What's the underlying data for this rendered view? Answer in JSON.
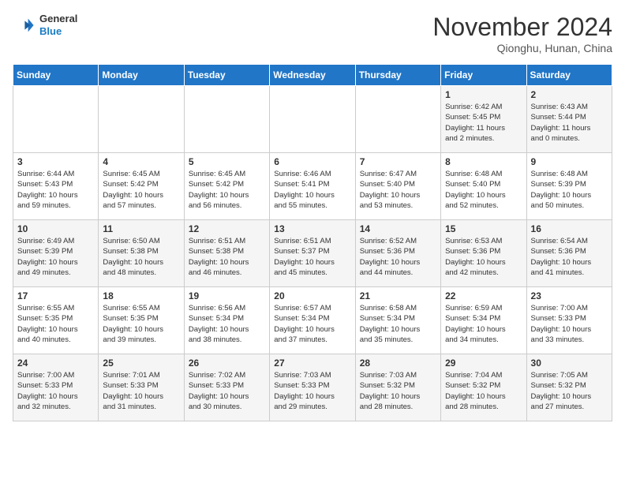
{
  "header": {
    "logo": {
      "line1": "General",
      "line2": "Blue"
    },
    "title": "November 2024",
    "location": "Qionghu, Hunan, China"
  },
  "weekdays": [
    "Sunday",
    "Monday",
    "Tuesday",
    "Wednesday",
    "Thursday",
    "Friday",
    "Saturday"
  ],
  "weeks": [
    [
      {
        "day": "",
        "info": ""
      },
      {
        "day": "",
        "info": ""
      },
      {
        "day": "",
        "info": ""
      },
      {
        "day": "",
        "info": ""
      },
      {
        "day": "",
        "info": ""
      },
      {
        "day": "1",
        "info": "Sunrise: 6:42 AM\nSunset: 5:45 PM\nDaylight: 11 hours\nand 2 minutes."
      },
      {
        "day": "2",
        "info": "Sunrise: 6:43 AM\nSunset: 5:44 PM\nDaylight: 11 hours\nand 0 minutes."
      }
    ],
    [
      {
        "day": "3",
        "info": "Sunrise: 6:44 AM\nSunset: 5:43 PM\nDaylight: 10 hours\nand 59 minutes."
      },
      {
        "day": "4",
        "info": "Sunrise: 6:45 AM\nSunset: 5:42 PM\nDaylight: 10 hours\nand 57 minutes."
      },
      {
        "day": "5",
        "info": "Sunrise: 6:45 AM\nSunset: 5:42 PM\nDaylight: 10 hours\nand 56 minutes."
      },
      {
        "day": "6",
        "info": "Sunrise: 6:46 AM\nSunset: 5:41 PM\nDaylight: 10 hours\nand 55 minutes."
      },
      {
        "day": "7",
        "info": "Sunrise: 6:47 AM\nSunset: 5:40 PM\nDaylight: 10 hours\nand 53 minutes."
      },
      {
        "day": "8",
        "info": "Sunrise: 6:48 AM\nSunset: 5:40 PM\nDaylight: 10 hours\nand 52 minutes."
      },
      {
        "day": "9",
        "info": "Sunrise: 6:48 AM\nSunset: 5:39 PM\nDaylight: 10 hours\nand 50 minutes."
      }
    ],
    [
      {
        "day": "10",
        "info": "Sunrise: 6:49 AM\nSunset: 5:39 PM\nDaylight: 10 hours\nand 49 minutes."
      },
      {
        "day": "11",
        "info": "Sunrise: 6:50 AM\nSunset: 5:38 PM\nDaylight: 10 hours\nand 48 minutes."
      },
      {
        "day": "12",
        "info": "Sunrise: 6:51 AM\nSunset: 5:38 PM\nDaylight: 10 hours\nand 46 minutes."
      },
      {
        "day": "13",
        "info": "Sunrise: 6:51 AM\nSunset: 5:37 PM\nDaylight: 10 hours\nand 45 minutes."
      },
      {
        "day": "14",
        "info": "Sunrise: 6:52 AM\nSunset: 5:36 PM\nDaylight: 10 hours\nand 44 minutes."
      },
      {
        "day": "15",
        "info": "Sunrise: 6:53 AM\nSunset: 5:36 PM\nDaylight: 10 hours\nand 42 minutes."
      },
      {
        "day": "16",
        "info": "Sunrise: 6:54 AM\nSunset: 5:36 PM\nDaylight: 10 hours\nand 41 minutes."
      }
    ],
    [
      {
        "day": "17",
        "info": "Sunrise: 6:55 AM\nSunset: 5:35 PM\nDaylight: 10 hours\nand 40 minutes."
      },
      {
        "day": "18",
        "info": "Sunrise: 6:55 AM\nSunset: 5:35 PM\nDaylight: 10 hours\nand 39 minutes."
      },
      {
        "day": "19",
        "info": "Sunrise: 6:56 AM\nSunset: 5:34 PM\nDaylight: 10 hours\nand 38 minutes."
      },
      {
        "day": "20",
        "info": "Sunrise: 6:57 AM\nSunset: 5:34 PM\nDaylight: 10 hours\nand 37 minutes."
      },
      {
        "day": "21",
        "info": "Sunrise: 6:58 AM\nSunset: 5:34 PM\nDaylight: 10 hours\nand 35 minutes."
      },
      {
        "day": "22",
        "info": "Sunrise: 6:59 AM\nSunset: 5:34 PM\nDaylight: 10 hours\nand 34 minutes."
      },
      {
        "day": "23",
        "info": "Sunrise: 7:00 AM\nSunset: 5:33 PM\nDaylight: 10 hours\nand 33 minutes."
      }
    ],
    [
      {
        "day": "24",
        "info": "Sunrise: 7:00 AM\nSunset: 5:33 PM\nDaylight: 10 hours\nand 32 minutes."
      },
      {
        "day": "25",
        "info": "Sunrise: 7:01 AM\nSunset: 5:33 PM\nDaylight: 10 hours\nand 31 minutes."
      },
      {
        "day": "26",
        "info": "Sunrise: 7:02 AM\nSunset: 5:33 PM\nDaylight: 10 hours\nand 30 minutes."
      },
      {
        "day": "27",
        "info": "Sunrise: 7:03 AM\nSunset: 5:33 PM\nDaylight: 10 hours\nand 29 minutes."
      },
      {
        "day": "28",
        "info": "Sunrise: 7:03 AM\nSunset: 5:32 PM\nDaylight: 10 hours\nand 28 minutes."
      },
      {
        "day": "29",
        "info": "Sunrise: 7:04 AM\nSunset: 5:32 PM\nDaylight: 10 hours\nand 28 minutes."
      },
      {
        "day": "30",
        "info": "Sunrise: 7:05 AM\nSunset: 5:32 PM\nDaylight: 10 hours\nand 27 minutes."
      }
    ]
  ]
}
